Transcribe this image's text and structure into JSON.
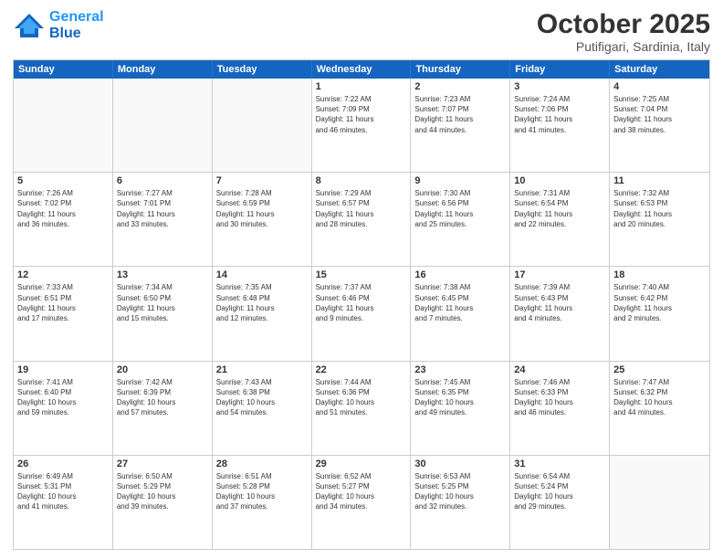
{
  "header": {
    "logo_line1": "General",
    "logo_line2": "Blue",
    "month": "October 2025",
    "location": "Putifigari, Sardinia, Italy"
  },
  "weekdays": [
    "Sunday",
    "Monday",
    "Tuesday",
    "Wednesday",
    "Thursday",
    "Friday",
    "Saturday"
  ],
  "rows": [
    [
      {
        "day": "",
        "info": ""
      },
      {
        "day": "",
        "info": ""
      },
      {
        "day": "",
        "info": ""
      },
      {
        "day": "1",
        "info": "Sunrise: 7:22 AM\nSunset: 7:09 PM\nDaylight: 11 hours\nand 46 minutes."
      },
      {
        "day": "2",
        "info": "Sunrise: 7:23 AM\nSunset: 7:07 PM\nDaylight: 11 hours\nand 44 minutes."
      },
      {
        "day": "3",
        "info": "Sunrise: 7:24 AM\nSunset: 7:06 PM\nDaylight: 11 hours\nand 41 minutes."
      },
      {
        "day": "4",
        "info": "Sunrise: 7:25 AM\nSunset: 7:04 PM\nDaylight: 11 hours\nand 38 minutes."
      }
    ],
    [
      {
        "day": "5",
        "info": "Sunrise: 7:26 AM\nSunset: 7:02 PM\nDaylight: 11 hours\nand 36 minutes."
      },
      {
        "day": "6",
        "info": "Sunrise: 7:27 AM\nSunset: 7:01 PM\nDaylight: 11 hours\nand 33 minutes."
      },
      {
        "day": "7",
        "info": "Sunrise: 7:28 AM\nSunset: 6:59 PM\nDaylight: 11 hours\nand 30 minutes."
      },
      {
        "day": "8",
        "info": "Sunrise: 7:29 AM\nSunset: 6:57 PM\nDaylight: 11 hours\nand 28 minutes."
      },
      {
        "day": "9",
        "info": "Sunrise: 7:30 AM\nSunset: 6:56 PM\nDaylight: 11 hours\nand 25 minutes."
      },
      {
        "day": "10",
        "info": "Sunrise: 7:31 AM\nSunset: 6:54 PM\nDaylight: 11 hours\nand 22 minutes."
      },
      {
        "day": "11",
        "info": "Sunrise: 7:32 AM\nSunset: 6:53 PM\nDaylight: 11 hours\nand 20 minutes."
      }
    ],
    [
      {
        "day": "12",
        "info": "Sunrise: 7:33 AM\nSunset: 6:51 PM\nDaylight: 11 hours\nand 17 minutes."
      },
      {
        "day": "13",
        "info": "Sunrise: 7:34 AM\nSunset: 6:50 PM\nDaylight: 11 hours\nand 15 minutes."
      },
      {
        "day": "14",
        "info": "Sunrise: 7:35 AM\nSunset: 6:48 PM\nDaylight: 11 hours\nand 12 minutes."
      },
      {
        "day": "15",
        "info": "Sunrise: 7:37 AM\nSunset: 6:46 PM\nDaylight: 11 hours\nand 9 minutes."
      },
      {
        "day": "16",
        "info": "Sunrise: 7:38 AM\nSunset: 6:45 PM\nDaylight: 11 hours\nand 7 minutes."
      },
      {
        "day": "17",
        "info": "Sunrise: 7:39 AM\nSunset: 6:43 PM\nDaylight: 11 hours\nand 4 minutes."
      },
      {
        "day": "18",
        "info": "Sunrise: 7:40 AM\nSunset: 6:42 PM\nDaylight: 11 hours\nand 2 minutes."
      }
    ],
    [
      {
        "day": "19",
        "info": "Sunrise: 7:41 AM\nSunset: 6:40 PM\nDaylight: 10 hours\nand 59 minutes."
      },
      {
        "day": "20",
        "info": "Sunrise: 7:42 AM\nSunset: 6:39 PM\nDaylight: 10 hours\nand 57 minutes."
      },
      {
        "day": "21",
        "info": "Sunrise: 7:43 AM\nSunset: 6:38 PM\nDaylight: 10 hours\nand 54 minutes."
      },
      {
        "day": "22",
        "info": "Sunrise: 7:44 AM\nSunset: 6:36 PM\nDaylight: 10 hours\nand 51 minutes."
      },
      {
        "day": "23",
        "info": "Sunrise: 7:45 AM\nSunset: 6:35 PM\nDaylight: 10 hours\nand 49 minutes."
      },
      {
        "day": "24",
        "info": "Sunrise: 7:46 AM\nSunset: 6:33 PM\nDaylight: 10 hours\nand 46 minutes."
      },
      {
        "day": "25",
        "info": "Sunrise: 7:47 AM\nSunset: 6:32 PM\nDaylight: 10 hours\nand 44 minutes."
      }
    ],
    [
      {
        "day": "26",
        "info": "Sunrise: 6:49 AM\nSunset: 5:31 PM\nDaylight: 10 hours\nand 41 minutes."
      },
      {
        "day": "27",
        "info": "Sunrise: 6:50 AM\nSunset: 5:29 PM\nDaylight: 10 hours\nand 39 minutes."
      },
      {
        "day": "28",
        "info": "Sunrise: 6:51 AM\nSunset: 5:28 PM\nDaylight: 10 hours\nand 37 minutes."
      },
      {
        "day": "29",
        "info": "Sunrise: 6:52 AM\nSunset: 5:27 PM\nDaylight: 10 hours\nand 34 minutes."
      },
      {
        "day": "30",
        "info": "Sunrise: 6:53 AM\nSunset: 5:25 PM\nDaylight: 10 hours\nand 32 minutes."
      },
      {
        "day": "31",
        "info": "Sunrise: 6:54 AM\nSunset: 5:24 PM\nDaylight: 10 hours\nand 29 minutes."
      },
      {
        "day": "",
        "info": ""
      }
    ]
  ]
}
